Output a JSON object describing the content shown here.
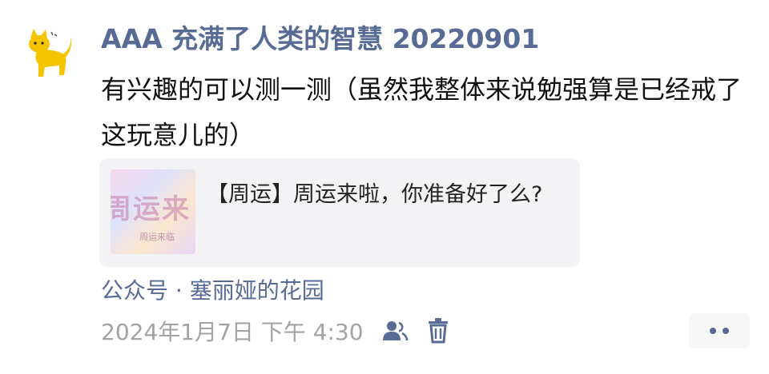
{
  "post": {
    "author": "AAA 充满了人类的智慧 20220901",
    "text": "有兴趣的可以测一测（虽然我整体来说勉强算是已经戒了这玩意儿的）",
    "avatar_icon": "yellow-cat-icon"
  },
  "card": {
    "thumb_text": "周运来",
    "thumb_subtext": "周运来临",
    "title": "【周运】周运来啦，你准备好了么?"
  },
  "source": "公众号 · 塞丽娅的花园",
  "meta": {
    "timestamp": "2024年1月7日 下午 4:30",
    "visibility_icon": "friends-icon",
    "delete_icon": "trash-icon"
  },
  "more_icon": "more-dots-icon",
  "colors": {
    "link": "#576b95",
    "text": "#111111",
    "timestamp": "#a3a3a3",
    "card_bg": "#f3f3f5"
  }
}
